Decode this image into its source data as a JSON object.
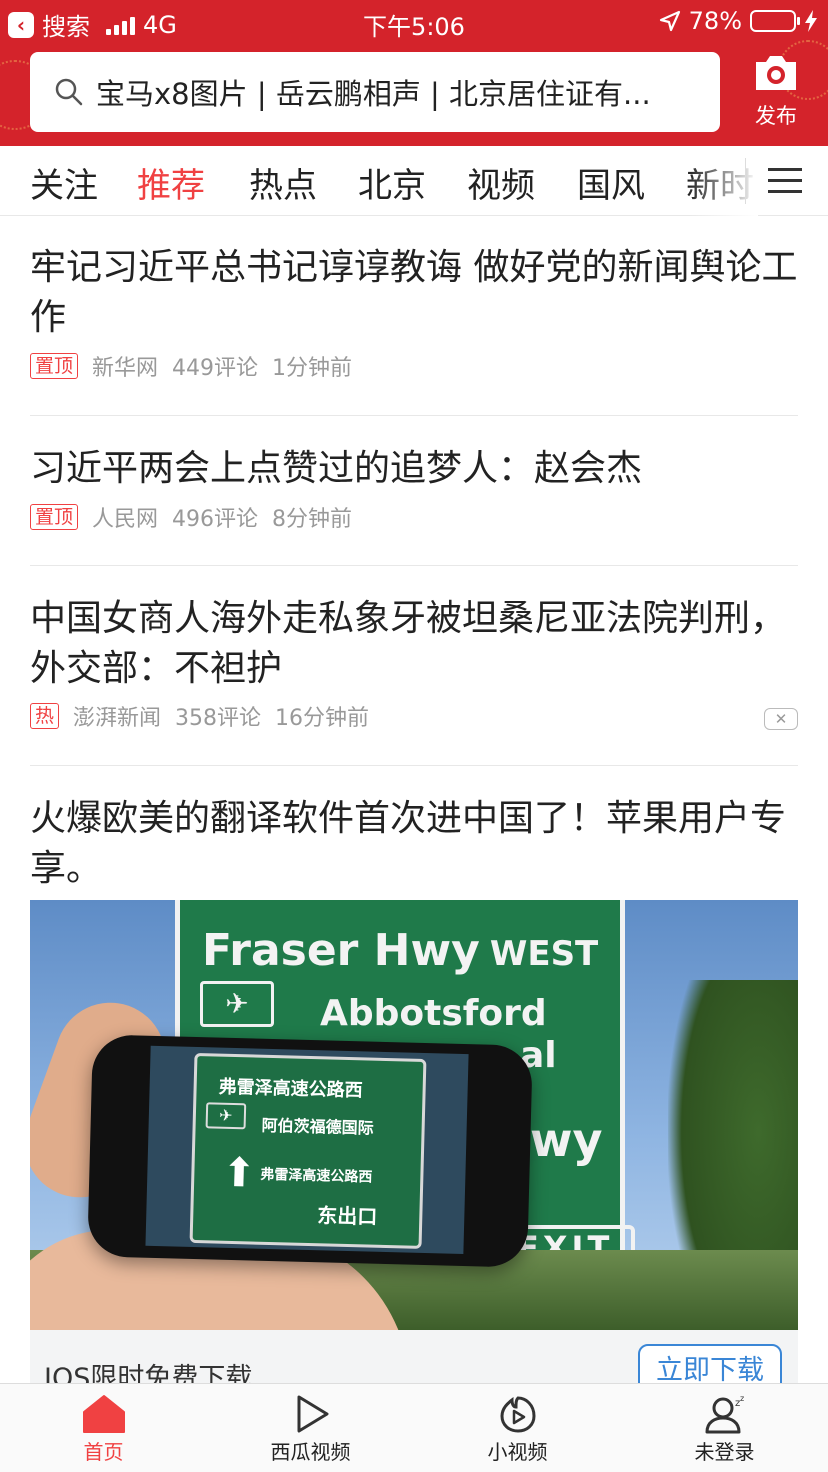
{
  "status_bar": {
    "back_label": "搜索",
    "network": "4G",
    "time": "下午5:06",
    "battery": "78%",
    "battery_level": 0.78
  },
  "search": {
    "text": "宝马x8图片 | 岳云鹏相声 | 北京居住证有..."
  },
  "publish_label": "发布",
  "tabs": [
    {
      "label": "关注",
      "active": false
    },
    {
      "label": "推荐",
      "active": true
    },
    {
      "label": "热点",
      "active": false
    },
    {
      "label": "北京",
      "active": false
    },
    {
      "label": "视频",
      "active": false
    },
    {
      "label": "国风",
      "active": false
    },
    {
      "label": "新时",
      "active": false
    }
  ],
  "articles": [
    {
      "title": "牢记习近平总书记谆谆教诲 做好党的新闻舆论工作",
      "badge": "置顶",
      "source": "新华网",
      "comments": "449评论",
      "time": "1分钟前"
    },
    {
      "title": "习近平两会上点赞过的追梦人：赵会杰",
      "badge": "置顶",
      "source": "人民网",
      "comments": "496评论",
      "time": "8分钟前"
    },
    {
      "title": "中国女商人海外走私象牙被坦桑尼亚法院判刑，外交部：不袒护",
      "badge": "热",
      "source": "澎湃新闻",
      "comments": "358评论",
      "time": "16分钟前",
      "dismiss_icon": "close-icon"
    }
  ],
  "ad": {
    "title": "火爆欧美的翻译软件首次进中国了！苹果用户专享。",
    "image": {
      "sign_line1": "Fraser Hwy",
      "sign_line1_suffix": "WEST",
      "sign_line2": "Abbotsford",
      "sign_line3": "al",
      "sign_line4": "wy",
      "sign_exit": "EXIT",
      "phone_line1": "弗雷泽高速公路西",
      "phone_line2": "阿伯茨福德国际",
      "phone_line3": "弗雷泽高速公路西",
      "phone_line4": "东出口"
    },
    "bar_text": "IOS限时免费下载",
    "button_label": "立即下载"
  },
  "bottom_nav": [
    {
      "label": "首页",
      "icon": "home-icon",
      "active": true
    },
    {
      "label": "西瓜视频",
      "icon": "play-icon",
      "active": false
    },
    {
      "label": "小视频",
      "icon": "short-video-icon",
      "active": false
    },
    {
      "label": "未登录",
      "icon": "user-icon",
      "active": false
    }
  ],
  "colors": {
    "header_red": "#d4232b",
    "accent_red": "#f04142",
    "link_blue": "#3a86d6"
  }
}
